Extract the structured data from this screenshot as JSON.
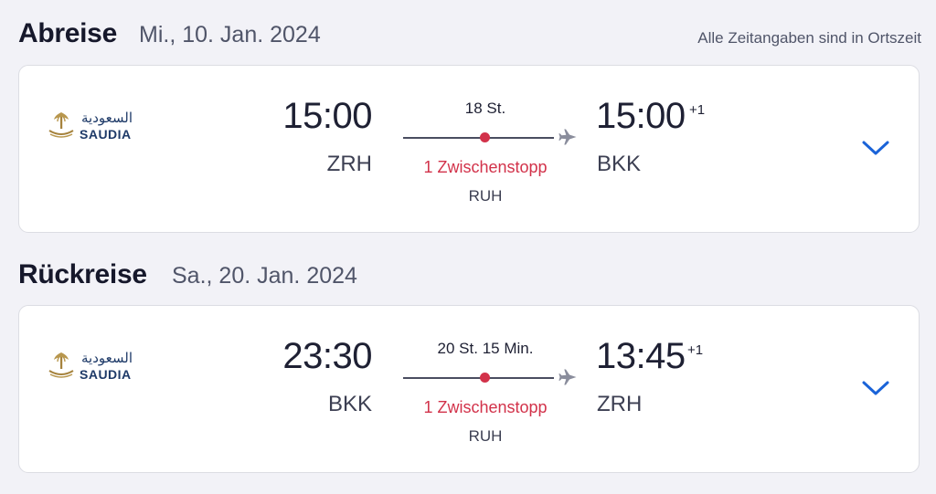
{
  "outbound": {
    "title": "Abreise",
    "date": "Mi., 10. Jan. 2024",
    "timezone_note": "Alle Zeitangaben sind in Ortszeit",
    "airline": {
      "arabic": "السعودية",
      "latin": "SAUDIA"
    },
    "departure_time": "15:00",
    "departure_code": "ZRH",
    "duration": "18 St.",
    "stops": "1 Zwischenstopp",
    "via": "RUH",
    "arrival_time": "15:00",
    "arrival_day_offset": "+1",
    "arrival_code": "BKK"
  },
  "return": {
    "title": "Rückreise",
    "date": "Sa., 20. Jan. 2024",
    "airline": {
      "arabic": "السعودية",
      "latin": "SAUDIA"
    },
    "departure_time": "23:30",
    "departure_code": "BKK",
    "duration": "20 St. 15 Min.",
    "stops": "1 Zwischenstopp",
    "via": "RUH",
    "arrival_time": "13:45",
    "arrival_day_offset": "+1",
    "arrival_code": "ZRH"
  },
  "colors": {
    "stop_accent": "#d2324a",
    "expand_accent": "#1a63d8",
    "background": "#f2f2f7"
  },
  "icons": {
    "plane": "airplane-icon",
    "expand": "chevron-down-icon",
    "logo": "saudia-palm-swords-icon"
  }
}
